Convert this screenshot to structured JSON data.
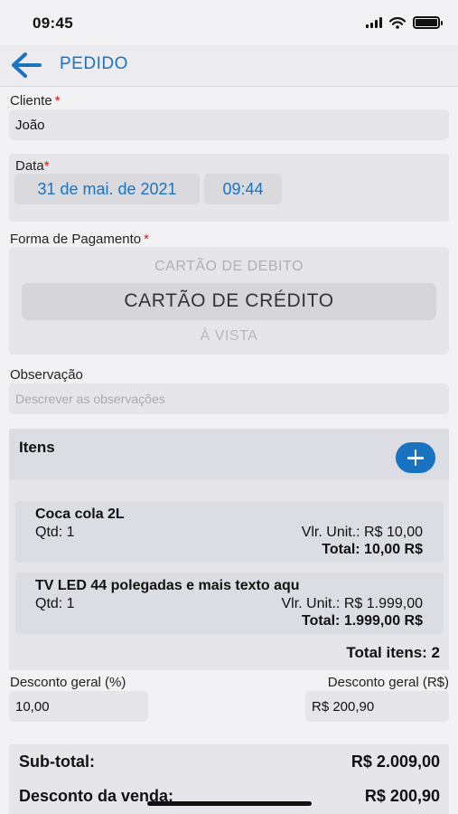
{
  "status_bar": {
    "time": "09:45"
  },
  "nav": {
    "title": "PEDIDO"
  },
  "cliente": {
    "label": "Cliente",
    "required": "*",
    "value": "João"
  },
  "data": {
    "label": "Data",
    "required": "*",
    "date": "31 de mai. de 2021",
    "time": "09:44"
  },
  "pagamento": {
    "label": "Forma de Pagamento",
    "required": "*",
    "options": [
      "CARTÃO DE DEBITO",
      "CARTÃO DE CRÉDITO",
      "À VISTA"
    ],
    "selected": "CARTÃO DE CRÉDITO"
  },
  "observacao": {
    "label": "Observação",
    "placeholder": "Descrever as observações"
  },
  "itens": {
    "title": "Itens",
    "items": [
      {
        "name": "Coca cola 2L",
        "qty": "Qtd: 1",
        "unit_price": "Vlr. Unit.: R$ 10,00",
        "total": "Total: 10,00 R$"
      },
      {
        "name": "TV LED 44 polegadas e mais texto aqu",
        "qty": "Qtd: 1",
        "unit_price": "Vlr. Unit.: R$ 1.999,00",
        "total": "Total: 1.999,00 R$"
      }
    ],
    "total_label": "Total itens: 2"
  },
  "descontos": {
    "percent_label": "Desconto geral (%)",
    "percent_value": "10,00",
    "value_label": "Desconto geral (R$)",
    "value_value": "R$ 200,90"
  },
  "resumo": {
    "subtotal_label": "Sub-total:",
    "subtotal_value": "R$ 2.009,00",
    "desconto_label": "Desconto da venda:",
    "desconto_value": "R$ 200,90"
  },
  "colors": {
    "accent": "#1a73c0",
    "required": "#dd1111"
  }
}
